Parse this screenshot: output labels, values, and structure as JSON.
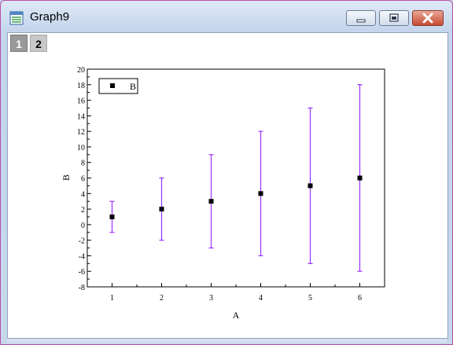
{
  "window": {
    "title": "Graph9",
    "icon": "graph-window-icon",
    "buttons": [
      "minimize-icon",
      "restore-icon",
      "close-icon"
    ],
    "close_color": "#c84a32"
  },
  "layers": [
    {
      "label": "1",
      "active": true
    },
    {
      "label": "2",
      "active": false
    }
  ],
  "chart_data": {
    "type": "scatter",
    "xlabel": "A",
    "ylabel": "B",
    "x": [
      1,
      2,
      3,
      4,
      5,
      6
    ],
    "series": [
      {
        "name": "B",
        "values": [
          1,
          2,
          3,
          4,
          5,
          6
        ],
        "error": [
          2,
          4,
          6,
          8,
          10,
          12
        ],
        "marker": "square",
        "marker_color": "#000000",
        "error_color": "#9b30ff"
      }
    ],
    "xlim": [
      0.5,
      6.5
    ],
    "ylim": [
      -8,
      20
    ],
    "xticks": [
      "1",
      "2",
      "3",
      "4",
      "5",
      "6"
    ],
    "yticks": [
      "-8",
      "-6",
      "-4",
      "-2",
      "0",
      "2",
      "4",
      "6",
      "8",
      "10",
      "12",
      "14",
      "16",
      "18",
      "20"
    ],
    "legend_position": "top-left",
    "grid": false
  }
}
